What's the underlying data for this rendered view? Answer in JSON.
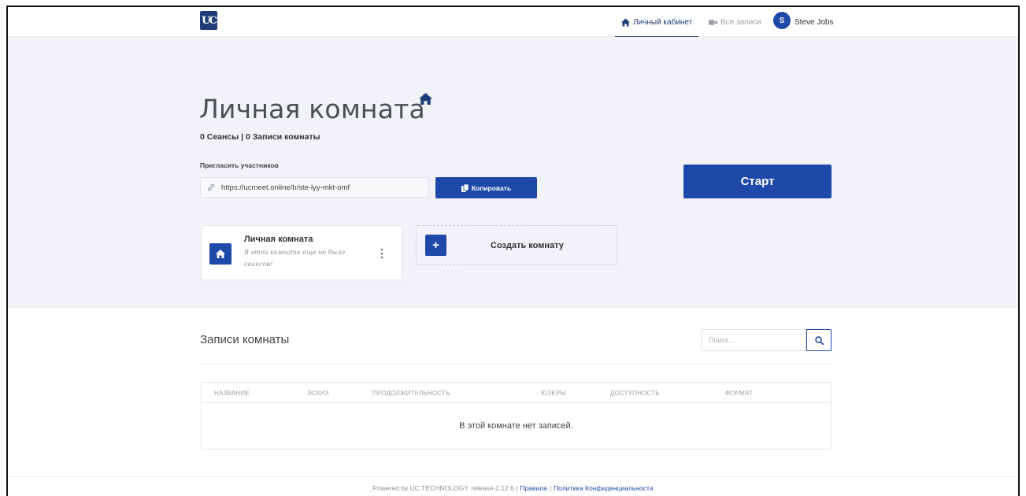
{
  "nav": {
    "logo_text": "UC",
    "personal_cabinet": "Личный кабинет",
    "all_recordings": "Все записи",
    "avatar_initial": "S",
    "user_name": "Steve Jobs"
  },
  "hero": {
    "title": "Личная комната",
    "stats": "0 Сеансы | 0 Записи комнаты",
    "invite_label": "Пригласить участников",
    "invite_url": "https://ucmeet.online/b/ste-lyy-mkt-omf",
    "copy_button": "Копировать",
    "start_button": "Старт"
  },
  "rooms": {
    "card_name": "Личная комната",
    "card_subtitle": "В этой комнате еще не было сеансов!",
    "create_label": "Создать комнату",
    "create_icon": "+"
  },
  "recordings": {
    "title": "Записи комнаты",
    "search_placeholder": "Поиск...",
    "columns": [
      "НАЗВАНИЕ",
      "ЭСКИЗ",
      "ПРОДОЛЖИТЕЛЬНОСТЬ",
      "ЮЗЕРЫ",
      "ДОСТУПНОСТЬ",
      "ФОРМАТ"
    ],
    "empty_message": "В этой комнате нет записей."
  },
  "footer": {
    "powered": "Powered by UC.TECHNOLOGY. release-2.12.6 |",
    "rules": "Правила",
    "separator": "|",
    "privacy": "Политика Конфиденциальности"
  },
  "colors": {
    "accent": "#1f49a8",
    "brand_dark": "#1f3d78",
    "hero_bg": "#f1f3f6"
  },
  "icons": {
    "nav_home": "home-icon",
    "nav_video": "video-icon",
    "link": "link-icon",
    "copy": "copy-icon",
    "search": "search-icon",
    "menu": "vertical-dots-icon"
  }
}
